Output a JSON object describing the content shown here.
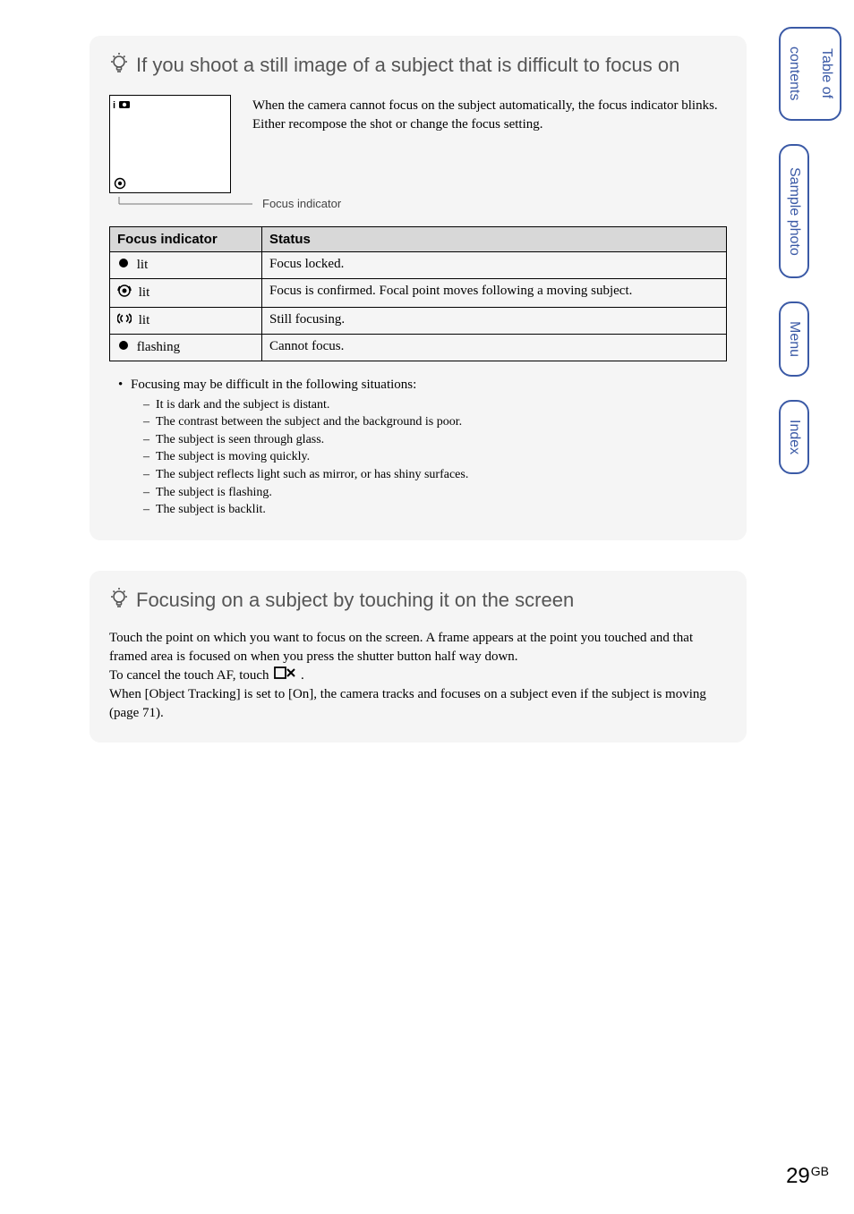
{
  "tip1": {
    "title": "If you shoot a still image of a subject that is difficult to focus on",
    "figure_text": "When the camera cannot focus on the subject automatically, the focus indicator blinks. Either recompose the shot or change the focus setting.",
    "figure_badge": "i▮",
    "leader_label": "Focus indicator",
    "table": {
      "headers": [
        "Focus indicator",
        "Status"
      ],
      "rows": [
        {
          "icon": "solid-dot",
          "label": "lit",
          "status": "Focus locked."
        },
        {
          "icon": "target-ring",
          "label": "lit",
          "status": "Focus is confirmed. Focal point moves following a moving subject."
        },
        {
          "icon": "arc-pair",
          "label": "lit",
          "status": "Still focusing."
        },
        {
          "icon": "solid-dot",
          "label": "flashing",
          "status": "Cannot focus."
        }
      ]
    },
    "bullet": "Focusing may be difficult in the following situations:",
    "subs": [
      "It is dark and the subject is distant.",
      "The contrast between the subject and the background is poor.",
      "The subject is seen through glass.",
      "The subject is moving quickly.",
      "The subject reflects light such as mirror, or has shiny surfaces.",
      "The subject is flashing.",
      "The subject is backlit."
    ]
  },
  "tip2": {
    "title": "Focusing on a subject by touching it on the screen",
    "p1a": "Touch the point on which you want to focus on the screen. A frame appears at the point you touched and that framed area is focused on when you press the shutter button half way down.",
    "p1b": "To cancel the touch AF, touch ",
    "p1c": ".",
    "p2": "When [Object Tracking] is set to [On], the camera tracks and focuses on a subject even if the subject is moving (page 71)."
  },
  "tabs": {
    "toc_l1": "Table of",
    "toc_l2": "contents",
    "sample": "Sample photo",
    "menu": "Menu",
    "index": "Index"
  },
  "page": {
    "num": "29",
    "suffix": "GB"
  }
}
